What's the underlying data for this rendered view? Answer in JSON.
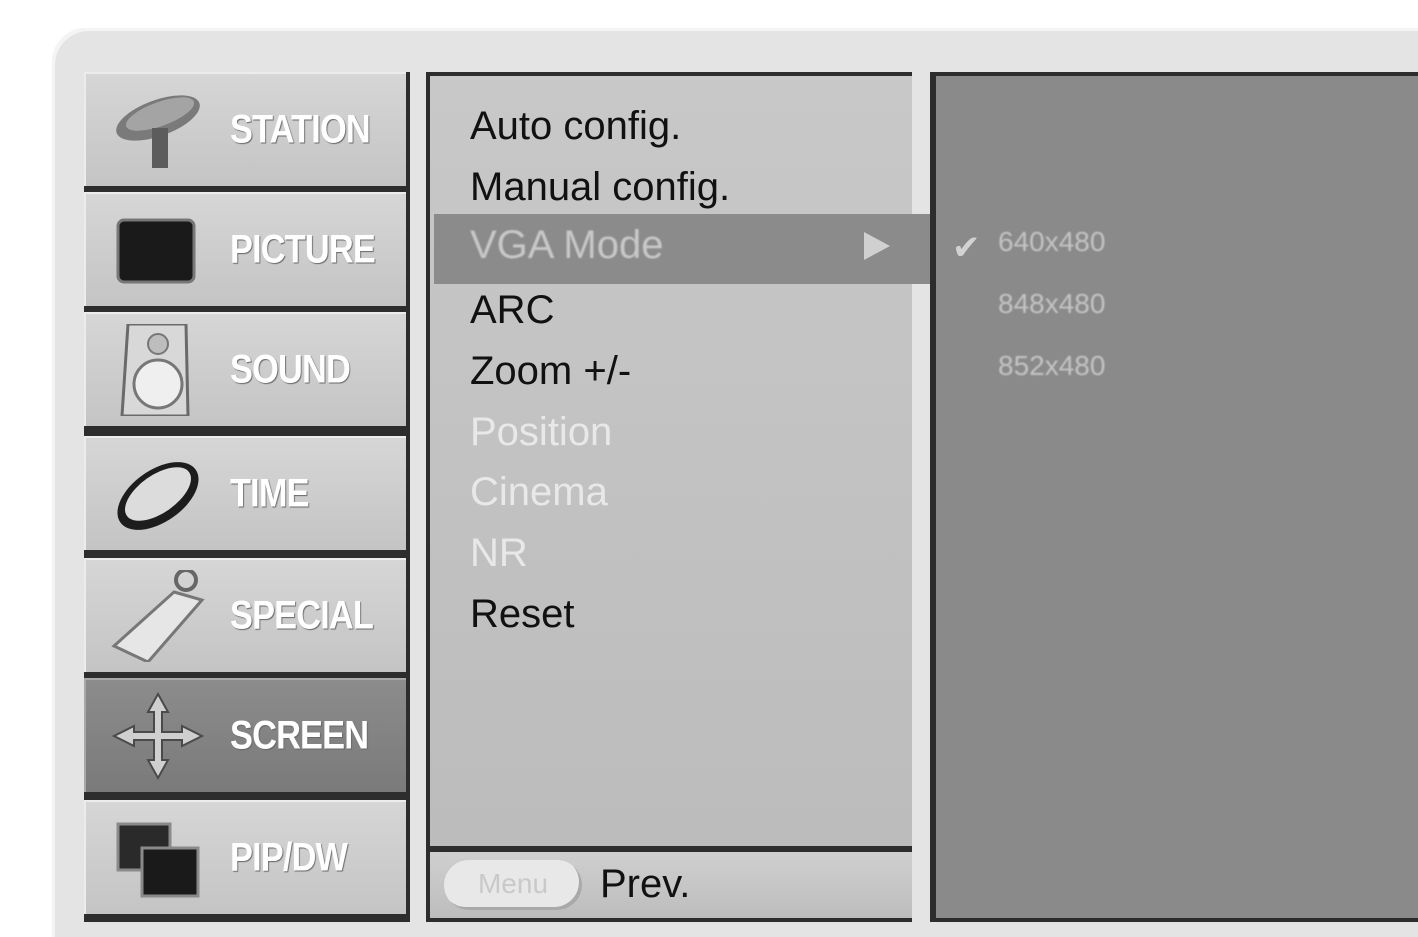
{
  "categories": [
    {
      "label": "STATION",
      "icon": "satellite-dish-icon",
      "active": false
    },
    {
      "label": "PICTURE",
      "icon": "tv-screen-icon",
      "active": false
    },
    {
      "label": "SOUND",
      "icon": "speaker-icon",
      "active": false
    },
    {
      "label": "TIME",
      "icon": "clock-icon",
      "active": false
    },
    {
      "label": "SPECIAL",
      "icon": "key-tag-icon",
      "active": false
    },
    {
      "label": "SCREEN",
      "icon": "move-arrows-icon",
      "active": true
    },
    {
      "label": "PIP/DW",
      "icon": "pip-windows-icon",
      "active": false
    }
  ],
  "submenu": {
    "items": [
      {
        "label": "Auto config.",
        "state": "enabled"
      },
      {
        "label": "Manual config.",
        "state": "enabled"
      },
      {
        "label": "VGA Mode",
        "state": "selected"
      },
      {
        "label": "ARC",
        "state": "enabled"
      },
      {
        "label": "Zoom +/-",
        "state": "enabled"
      },
      {
        "label": "Position",
        "state": "disabled"
      },
      {
        "label": "Cinema",
        "state": "disabled"
      },
      {
        "label": "NR",
        "state": "disabled"
      },
      {
        "label": "Reset",
        "state": "enabled"
      }
    ],
    "footer": {
      "menu_button": "Menu",
      "prev_label": "Prev."
    }
  },
  "vga_modes": [
    "640x480",
    "848x480",
    "852x480"
  ],
  "colors": {
    "panel": "#c0c0c0",
    "selected": "#8b8b8b",
    "value_panel": "#8a8a8a",
    "text_disabled": "#e8e8e8"
  }
}
